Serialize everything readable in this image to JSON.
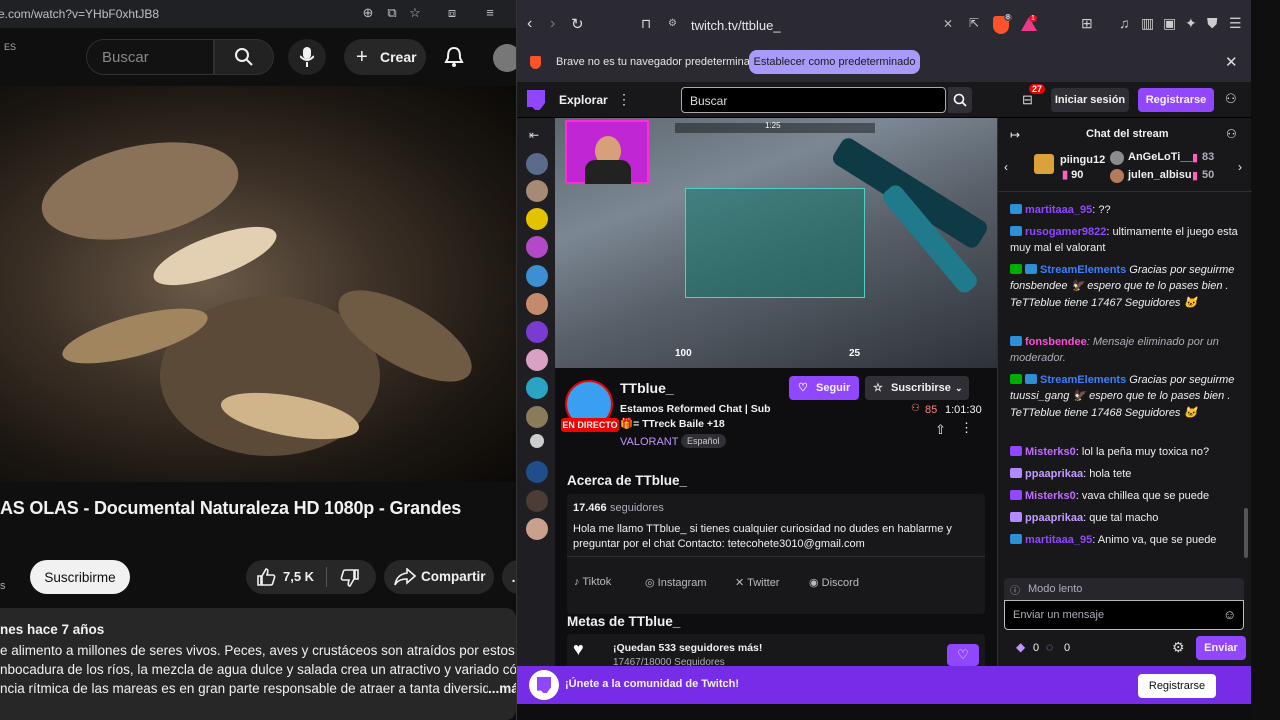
{
  "youtube": {
    "url": "e.com/watch?v=YHbF0xhtJB8",
    "region": "ES",
    "search_placeholder": "Buscar",
    "create_label": "Crear",
    "title": "AS OLAS - Documental Naturaleza HD 1080p - Grandes",
    "subscribe_label": "Suscribirme",
    "likes": "7,5 K",
    "share_label": "Compartir",
    "channel_fragment": "s",
    "description": {
      "meta": "nes  hace 7 años",
      "lines": [
        "e alimento a millones de seres vivos. Peces, aves y crustáceos son atraídos por estos",
        "nbocadura de los ríos, la mezcla de agua dulce y salada crea un atractivo y variado cóctel.",
        "ncia rítmica de las mareas es en gran parte responsable de atraer a tanta diversidad"
      ],
      "more": "...má"
    }
  },
  "browser": {
    "url": "twitch.tv/ttblue_",
    "notice_text": "Brave no es tu navegador predeterminado",
    "notice_button": "Establecer como predeterminado",
    "shield_count": "8",
    "rewards_count": "1"
  },
  "twitch": {
    "explore_label": "Explorar",
    "search_placeholder": "Buscar",
    "notification_count": "27",
    "login_label": "Iniciar sesión",
    "signup_label": "Registrarse",
    "player": {
      "hud_health": "100",
      "hud_ammo": "25",
      "hud_timer": "1:25"
    },
    "stream": {
      "channel_name": "TTblue_",
      "live_label": "EN DIRECTO",
      "follow_label": "Seguir",
      "subscribe_label": "Suscribirse",
      "title": "Estamos Reformed Chat | Sub 🎁= TTreck Baile +18",
      "viewers": "85",
      "uptime": "1:01:30",
      "game": "VALORANT",
      "language_tag": "Español"
    },
    "about": {
      "heading": "Acerca de TTblue_",
      "followers_count": "17.466",
      "followers_label": "seguidores",
      "bio": "Hola me llamo TTblue_ si tienes cualquier curiosidad no dudes en hablarme y preguntar por el chat Contacto: tetecohete3010@gmail.com",
      "socials": [
        "Tiktok",
        "Instagram",
        "Twitter",
        "Discord"
      ]
    },
    "goals": {
      "heading": "Metas de TTblue_",
      "goal_text": "¡Quedan 533 seguidores más!",
      "goal_current": "17467",
      "goal_target": "/18000 Seguidores"
    },
    "chat": {
      "title": "Chat del stream",
      "gifters": [
        {
          "name": "piingu12",
          "count": "90"
        },
        {
          "name": "AnGeLoTi__",
          "count": "83"
        },
        {
          "name": "julen_albisu",
          "count": "50"
        }
      ],
      "messages": [
        {
          "user": "martitaaa_95",
          "text": ": ??",
          "color": "#9147ff"
        },
        {
          "user": "rusogamer9822",
          "text": ": ultimamente el juego esta muy mal el valorant",
          "color": "#9147ff"
        },
        {
          "user": "StreamElements",
          "text": " Gracias por seguirme fonsbendee 🦅 espero que te lo pases bien . TeTTeblue tiene 17467 Seguidores 🐱",
          "color": "#3d7eff"
        },
        {
          "user": "fonsbendee",
          "text": ": Mensaje eliminado por un moderador.",
          "color": "#ff4dd8"
        },
        {
          "user": "StreamElements",
          "text": " Gracias por seguirme tuussi_gang 🦅 espero que te lo pases bien . TeTTeblue tiene 17468 Seguidores 🐱",
          "color": "#3d7eff"
        },
        {
          "user": "Misterks0",
          "text": ": lol la peña muy toxica no?",
          "color": "#c16cff"
        },
        {
          "user": "ppaaprikaa",
          "text": ": hola tete",
          "color": "#c29cff"
        },
        {
          "user": "Misterks0",
          "text": ": vava chillea que se puede",
          "color": "#c16cff"
        },
        {
          "user": "ppaaprikaa",
          "text": ": que tal macho",
          "color": "#c29cff"
        },
        {
          "user": "martitaaa_95",
          "text": ": Animo va, que se puede",
          "color": "#9147ff"
        }
      ],
      "slow_mode_label": "Modo lento",
      "input_placeholder": "Enviar un mensaje",
      "points_a": "0",
      "points_b": "0",
      "send_label": "Enviar"
    },
    "banner": {
      "text": "¡Únete a la comunidad de Twitch!",
      "button": "Registrarse"
    }
  }
}
